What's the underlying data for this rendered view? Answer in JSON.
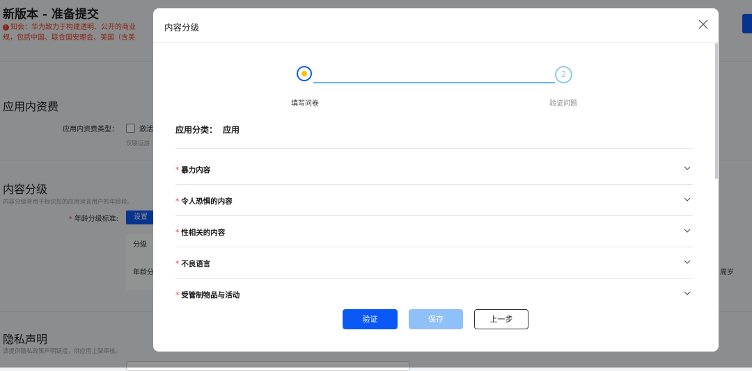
{
  "background": {
    "page_title": "新版本 - 准备提交",
    "notice": "知会：华为致力于构建透明、公开的商业",
    "notice_line2": "规，包括中国、联合国安理会、美国（含美",
    "section_iap": "应用内资费",
    "iap_type_label": "应用内资费类型：",
    "iap_option_partial": "激活",
    "iap_hint": "仅联运游",
    "section_content_rating": "内容分级",
    "content_rating_desc": "内容分级将用于标识您的应用适宜用户的年龄段。",
    "age_standard_label": "年龄分级标准:",
    "set_button": "设置",
    "table_header_partial": "分级",
    "table_cell_partial": "年龄分",
    "right_cell_partial": "周岁",
    "section_privacy": "隐私声明",
    "privacy_desc": "请提供隐私政策声明链接，供应用上架审核。"
  },
  "modal": {
    "title": "内容分级",
    "steps": [
      {
        "number": "1",
        "label": "填写问卷",
        "state": "active"
      },
      {
        "number": "2",
        "label": "验证问题",
        "state": "pending"
      }
    ],
    "category_label": "应用分类：",
    "category_value": "应用",
    "questions": [
      {
        "label": "暴力内容",
        "required": "*"
      },
      {
        "label": "令人恐惧的内容",
        "required": "*"
      },
      {
        "label": "性相关的内容",
        "required": "*"
      },
      {
        "label": "不良语言",
        "required": "*"
      },
      {
        "label": "受管制物品与活动",
        "required": "*"
      }
    ],
    "buttons": {
      "verify": "验证",
      "save": "保存",
      "previous": "上一步"
    }
  },
  "colors": {
    "primary": "#0a59f7",
    "primary_disabled": "#8fc0f8",
    "step_pending": "#8fcaf5",
    "step_dot": "#f7c500",
    "required_star": "#e84026"
  },
  "icons": {
    "close": "close-icon",
    "chevron": "chevron-down-icon",
    "warning": "warning-icon"
  }
}
